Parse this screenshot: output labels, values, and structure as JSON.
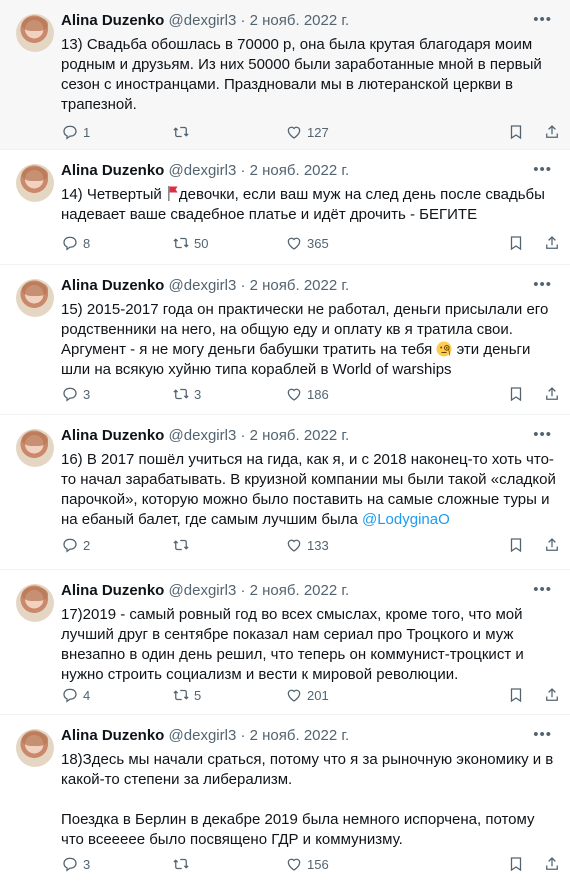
{
  "tweets": [
    {
      "author": "Alina Duzenko",
      "handle": "@dexgirl3",
      "separator": "·",
      "date": "2 нояб. 2022 г.",
      "paragraphs": [
        "13) Свадьба обошлась в 70000 р, она была крутая благодаря моим родным и друзьям. Из них 50000 были заработанные мной в первый сезон с иностранцами. Праздновали мы в лютеранской церкви в трапезной."
      ],
      "replies": "1",
      "retweets": "",
      "likes": "127"
    },
    {
      "author": "Alina Duzenko",
      "handle": "@dexgirl3",
      "separator": "·",
      "date": "2 нояб. 2022 г.",
      "text_before": "14) Четвертый ",
      "text_after": "девочки, если ваш муж на след день после свадьбы надевает ваше свадебное платье  и идёт дрочить - БЕГИТЕ",
      "replies": "8",
      "retweets": "50",
      "likes": "365"
    },
    {
      "author": "Alina Duzenko",
      "handle": "@dexgirl3",
      "separator": "·",
      "date": "2 нояб. 2022 г.",
      "text_before": "15) 2015-2017 года он практически не работал, деньги присылали его родственники на него, на общую еду и оплату кв я тратила свои. Аргумент - я не могу деньги бабушки тратить на тебя ",
      "text_after": " эти деньги шли на всякую хуйню типа кораблей в World of warships",
      "replies": "3",
      "retweets": "3",
      "likes": "186"
    },
    {
      "author": "Alina Duzenko",
      "handle": "@dexgirl3",
      "separator": "·",
      "date": "2 нояб. 2022 г.",
      "text_before": "16) В 2017 пошёл учиться на гида, как я, и с 2018 наконец-то хоть что-то начал зарабатывать. В круизной компании мы были такой «сладкой парочкой», которую можно было поставить на самые сложные туры и на ебаный балет, где самым лучшим была ",
      "mention": "@LodyginaO",
      "replies": "2",
      "retweets": "",
      "likes": "133"
    },
    {
      "author": "Alina Duzenko",
      "handle": "@dexgirl3",
      "separator": "·",
      "date": "2 нояб. 2022 г.",
      "paragraphs": [
        "17)2019 - самый ровный год во всех смыслах, кроме того, что мой лучший друг в сентябре показал нам сериал про Троцкого и муж внезапно в один день решил, что теперь он коммунист-троцкист и нужно строить социализм и вести к мировой революции."
      ],
      "replies": "4",
      "retweets": "5",
      "likes": "201"
    },
    {
      "author": "Alina Duzenko",
      "handle": "@dexgirl3",
      "separator": "·",
      "date": "2 нояб. 2022 г.",
      "paragraphs": [
        "18)Здесь мы начали сраться, потому что я за рыночную экономику и в какой-то степени за либерализм.",
        "Поездка в Берлин в декабре 2019 была немного испорчена, потому что всеееее было посвящено ГДР и коммунизму."
      ],
      "replies": "3",
      "retweets": "",
      "likes": "156"
    }
  ],
  "icons": {
    "reply": "reply-icon",
    "retweet": "retweet-icon",
    "like": "heart-icon",
    "bookmark": "bookmark-icon",
    "share": "share-icon",
    "more": "more-icon",
    "flag": "red-flag-emoji",
    "emoji": "monocle-face-emoji"
  },
  "colors": {
    "text": "#0f1419",
    "secondary": "#536471",
    "link": "#1d9bf0",
    "highlight_bg": "#f7f7f7"
  }
}
